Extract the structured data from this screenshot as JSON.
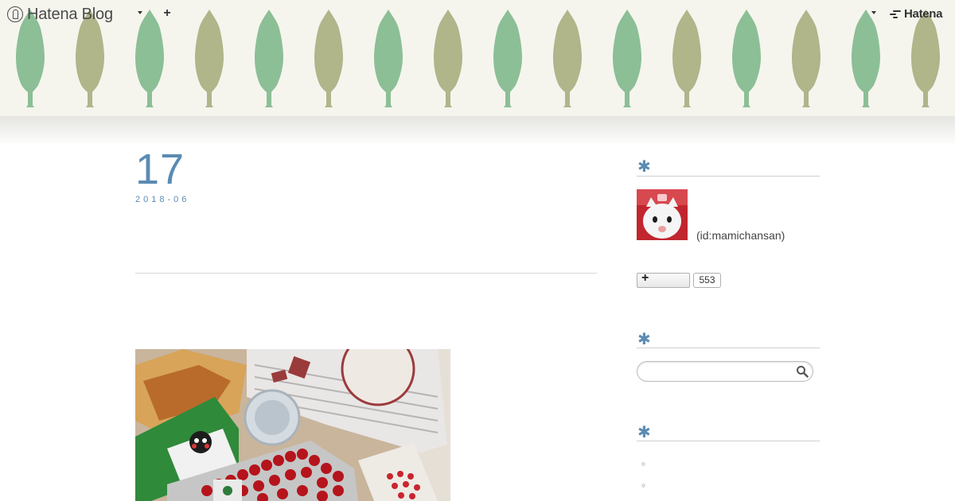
{
  "header": {
    "logo_text": "Hatena Blog",
    "add_label": "+",
    "hatena_label": "Hatena"
  },
  "entry": {
    "day": "17",
    "year_month": "2018-06"
  },
  "sidebar": {
    "module_symbol": "✱",
    "profile": {
      "id_text": "(id:mamichansan)"
    },
    "follow": {
      "button_label": "+",
      "count": "553"
    },
    "search": {
      "placeholder": "",
      "icon": "search-icon"
    },
    "list_bullets": [
      "◦",
      "◦"
    ]
  },
  "colors": {
    "accent": "#5b8bb3",
    "tree_green": "#8cbf95",
    "tree_olive": "#b0b58a",
    "header_bg": "#f5f5ee"
  }
}
